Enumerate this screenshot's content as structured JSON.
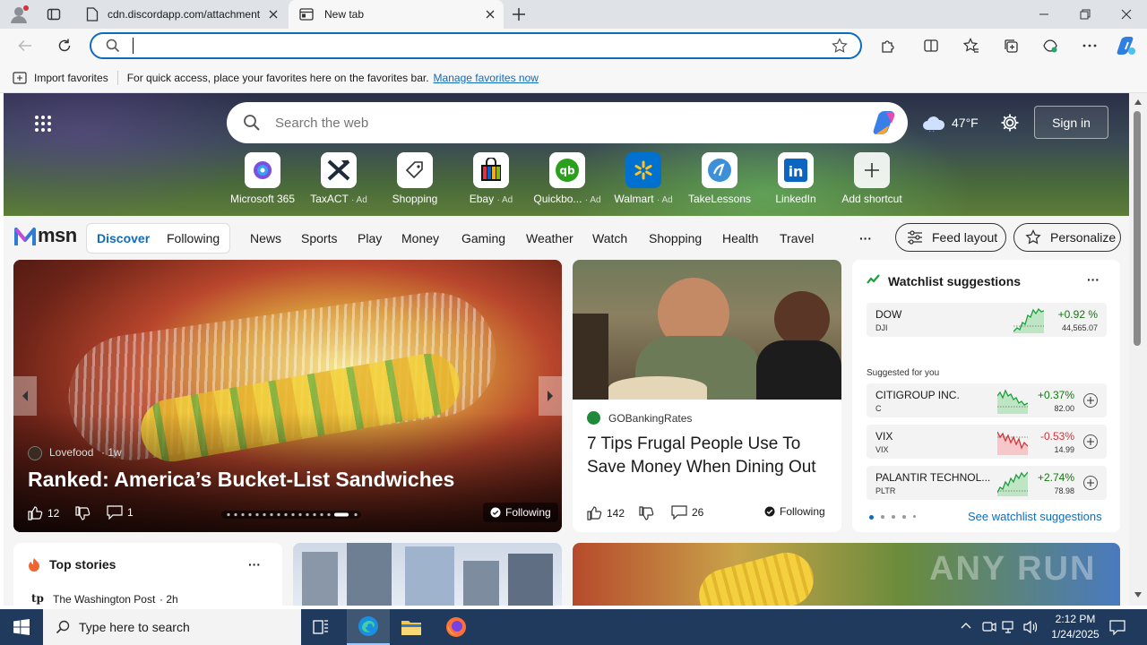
{
  "browser": {
    "tabs": [
      {
        "title": "cdn.discordapp.com/attachment",
        "active": false
      },
      {
        "title": "New tab",
        "active": true
      }
    ],
    "address": {
      "value": "",
      "placeholder": ""
    },
    "favbar": {
      "import_label": "Import favorites",
      "hint": "For quick access, place your favorites here on the favorites bar.",
      "manage_link": "Manage favorites now"
    }
  },
  "ntp": {
    "search_placeholder": "Search the web",
    "weather": {
      "temp": "47°F",
      "icon": "cloud-icon"
    },
    "sign_in": "Sign in",
    "shortcuts": [
      {
        "label": "Microsoft 365",
        "ad": ""
      },
      {
        "label": "TaxACT",
        "ad": "· Ad"
      },
      {
        "label": "Shopping",
        "ad": ""
      },
      {
        "label": "Ebay",
        "ad": "· Ad"
      },
      {
        "label": "Quickbo...",
        "ad": "· Ad"
      },
      {
        "label": "Walmart",
        "ad": "· Ad"
      },
      {
        "label": "TakeLessons",
        "ad": ""
      },
      {
        "label": "LinkedIn",
        "ad": ""
      },
      {
        "label": "Add shortcut",
        "ad": ""
      }
    ]
  },
  "msn": {
    "logo": "msn",
    "tabs": [
      "Discover",
      "Following"
    ],
    "nav": [
      "News",
      "Sports",
      "Play",
      "Money",
      "Gaming",
      "Weather",
      "Watch",
      "Shopping",
      "Health",
      "Travel"
    ],
    "more": "···",
    "feed_layout": "Feed layout",
    "personalize": "Personalize"
  },
  "hero_story": {
    "source": "Lovefood",
    "age": "· 1w",
    "headline": "Ranked: America’s Bucket-List Sandwiches",
    "likes": "12",
    "comments": "1",
    "following": "Following"
  },
  "story2": {
    "source": "GOBankingRates",
    "headline": "7 Tips Frugal People Use To Save Money When Dining Out",
    "likes": "142",
    "comments": "26",
    "following": "Following"
  },
  "watchlist": {
    "title": "Watchlist suggestions",
    "more": "···",
    "top": {
      "name": "DOW",
      "sym": "DJI",
      "change": "+0.92 %",
      "price": "44,565.07"
    },
    "suggested_label": "Suggested for you",
    "items": [
      {
        "name": "CITIGROUP INC.",
        "sym": "C",
        "change": "+0.37%",
        "price": "82.00",
        "dir": "up"
      },
      {
        "name": "VIX",
        "sym": "VIX",
        "change": "-0.53%",
        "price": "14.99",
        "dir": "down"
      },
      {
        "name": "PALANTIR TECHNOL...",
        "sym": "PLTR",
        "change": "+2.74%",
        "price": "78.98",
        "dir": "up"
      }
    ],
    "see_link": "See watchlist suggestions",
    "colors": {
      "up": "#0e7a0d",
      "down": "#d13438"
    }
  },
  "top_stories": {
    "title": "Top stories",
    "more": "···",
    "first_source": "The Washington Post",
    "first_age": "· 2h"
  },
  "taskbar": {
    "search_placeholder": "Type here to search",
    "time": "2:12 PM",
    "date": "1/24/2025"
  },
  "watermark": "ANY RUN"
}
